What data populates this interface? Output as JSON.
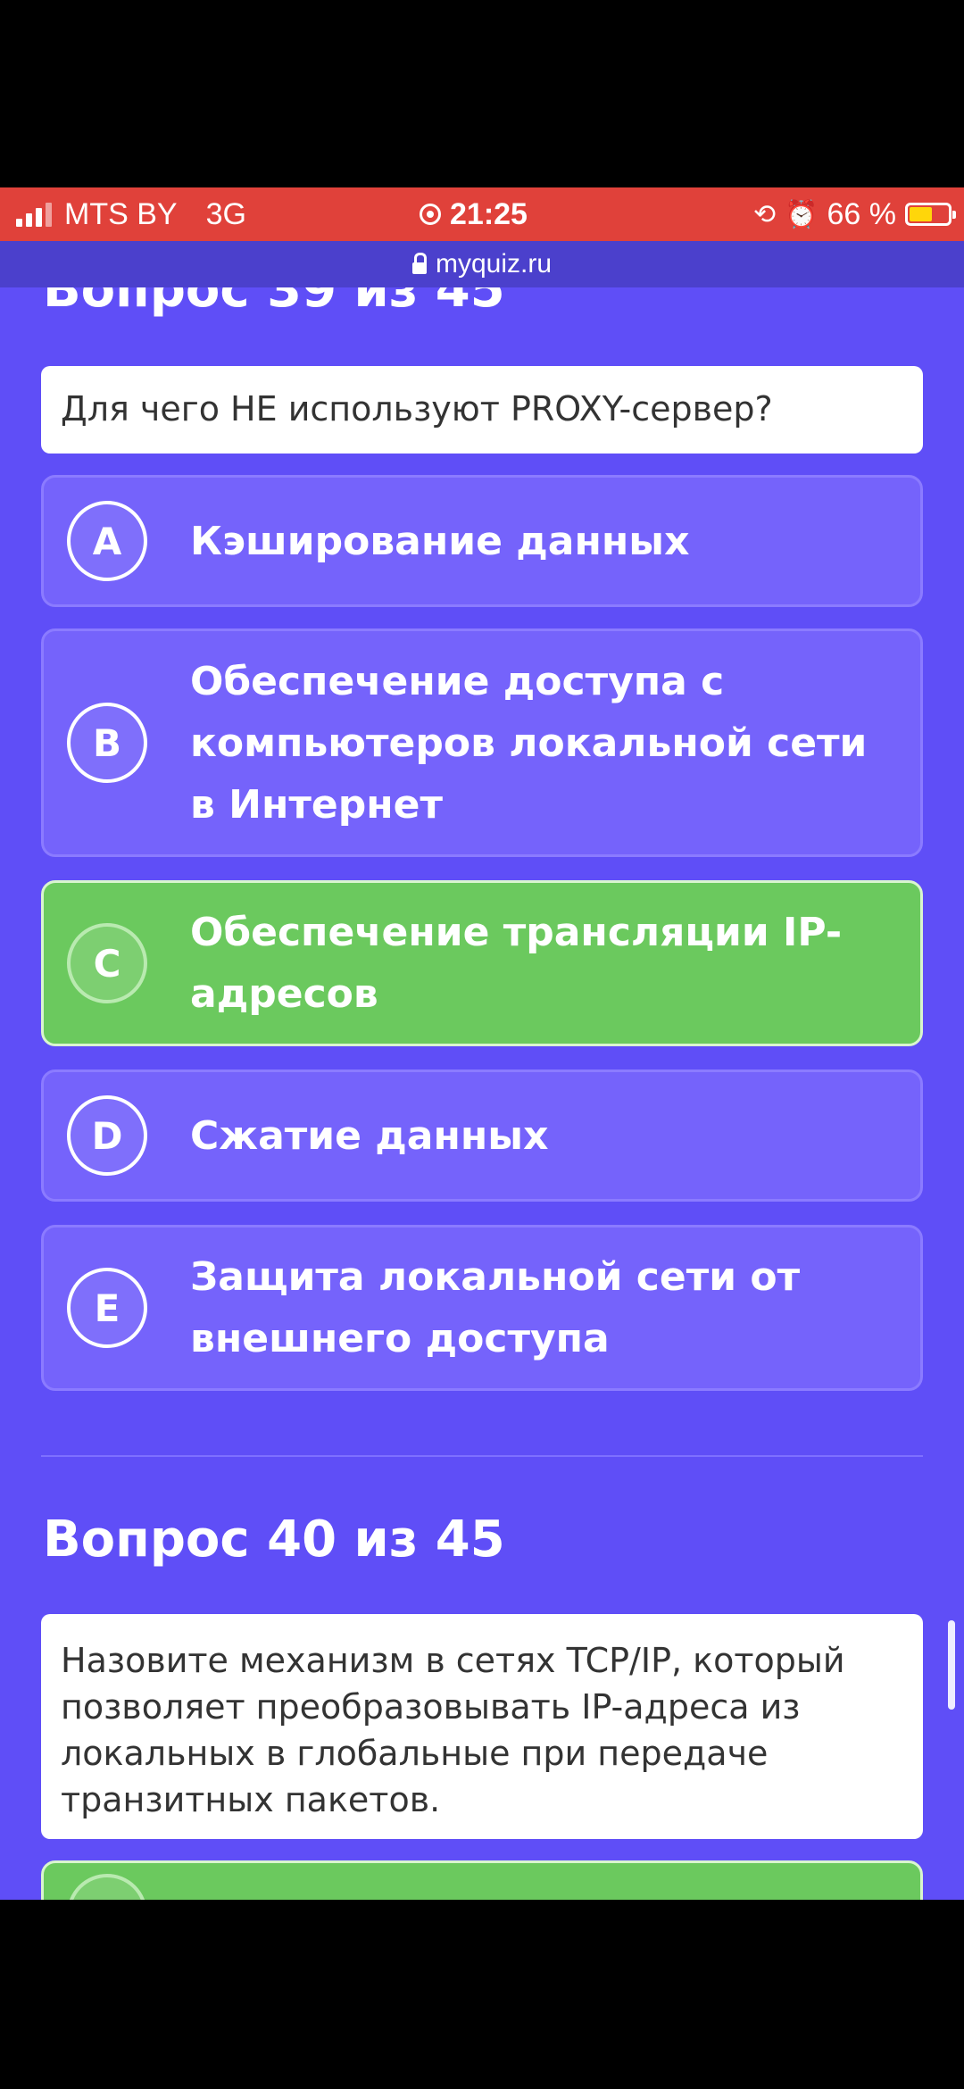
{
  "status_bar": {
    "carrier": "MTS BY",
    "network": "3G",
    "time": "21:25",
    "battery": "66 %",
    "battery_level": 0.66
  },
  "browser": {
    "url": "myquiz.ru"
  },
  "questions": [
    {
      "title": "Вопрос 39 из 45",
      "text": "Для чего НЕ используют PROXY-сервер?",
      "answers": [
        {
          "letter": "A",
          "text": "Кэширование данных",
          "state": "default"
        },
        {
          "letter": "B",
          "text": "Обеспечение доступа с компьютеров локальной сети в Интернет",
          "state": "default"
        },
        {
          "letter": "C",
          "text": "Обеспечение трансляции IP-адресов",
          "state": "correct"
        },
        {
          "letter": "D",
          "text": "Сжатие данных",
          "state": "default"
        },
        {
          "letter": "E",
          "text": "Защита локальной сети от внешнего доступа",
          "state": "default"
        }
      ]
    },
    {
      "title": "Вопрос 40 из 45",
      "text": "Назовите механизм в сетях TCP/IP, который позволяет преобразовывать IP-адреса из локальных в глобальные при передаче транзитных пакетов."
    }
  ],
  "colors": {
    "background": "#5f4ef7",
    "answer_default": "#7563fb",
    "answer_correct": "#6bc95e",
    "status_bar": "#e0413a"
  }
}
